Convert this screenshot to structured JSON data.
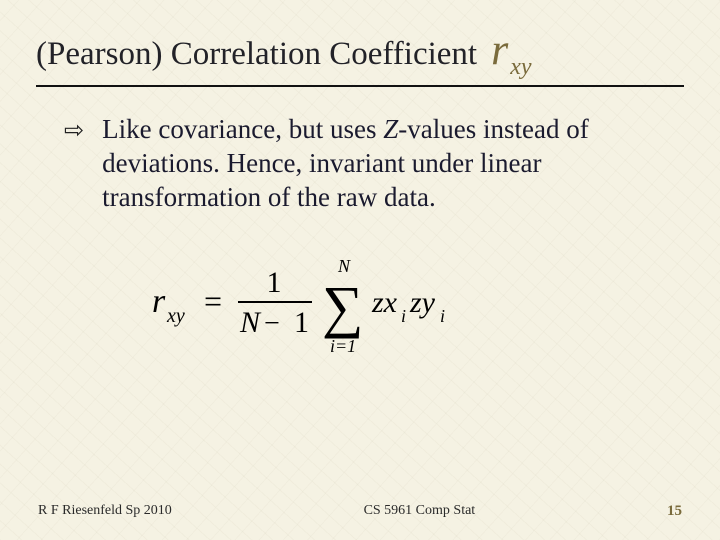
{
  "title": {
    "text": "(Pearson) Correlation Coefficient",
    "symbol_main": "r",
    "symbol_sub": "xy"
  },
  "body": {
    "bullet_glyph": "⇨",
    "line1a": "Like covariance, but uses ",
    "z": "Z",
    "line1b": "-values instead of deviations.  Hence, invariant under linear transformation of the raw data."
  },
  "formula": {
    "lhs_r": "r",
    "lhs_sub": "xy",
    "eq": "=",
    "num": "1",
    "den_N": "N",
    "den_minus": "−",
    "den_1": "1",
    "sigma": "∑",
    "upper": "N",
    "lower": "i=1",
    "zx": "zx",
    "i1": "i",
    "zy": "zy",
    "i2": "i"
  },
  "footer": {
    "left": "R F Riesenfeld Sp 2010",
    "center": "CS 5961 Comp Stat",
    "page": "15"
  }
}
